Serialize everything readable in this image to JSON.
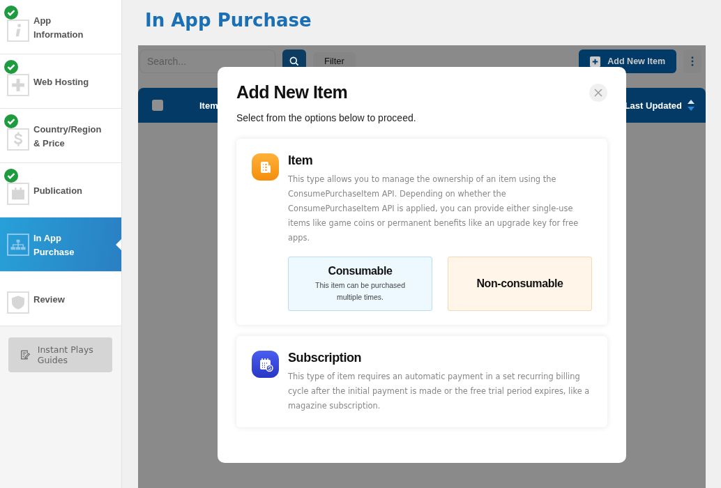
{
  "sidebar": {
    "steps": [
      {
        "label": "App Information",
        "completed": true,
        "selected": false
      },
      {
        "label": "Web Hosting",
        "completed": true,
        "selected": false
      },
      {
        "label": "Country/Region & Price",
        "completed": true,
        "selected": false
      },
      {
        "label": "Publication",
        "completed": true,
        "selected": false
      },
      {
        "label": "In App Purchase",
        "completed": false,
        "selected": true
      },
      {
        "label": "Review",
        "completed": false,
        "selected": false
      }
    ],
    "guide_button": "Instant Plays Guides"
  },
  "page_title": "In App Purchase",
  "toolbar": {
    "search": {
      "placeholder": "Search..."
    },
    "filter": "Filter",
    "add_button": "Add New Item"
  },
  "table": {
    "select_all_checked": false,
    "columns": [
      "Item",
      "Last Updated"
    ]
  },
  "modal": {
    "title": "Add New Item",
    "subtitle": "Select from the options below to proceed.",
    "options": [
      {
        "kind": "item",
        "title": "Item",
        "description": "This type allows you to manage the ownership of an item using the ConsumePurchaseItem API. Depending on whether the ConsumePurchaseItem API is applied, you can provide either single-use items like game coins or permanent benefits like an upgrade key for free apps.",
        "choices": [
          {
            "kind": "consumable",
            "title": "Consumable",
            "description": "This item can be purchased multiple times."
          },
          {
            "kind": "non-consumable",
            "title": "Non-consumable"
          }
        ]
      },
      {
        "kind": "subscription",
        "title": "Subscription",
        "description": "This type of item requires an automatic payment in a set recurring billing cycle after the initial payment is made or the free trial period expires, like a magazine subscription."
      }
    ]
  }
}
